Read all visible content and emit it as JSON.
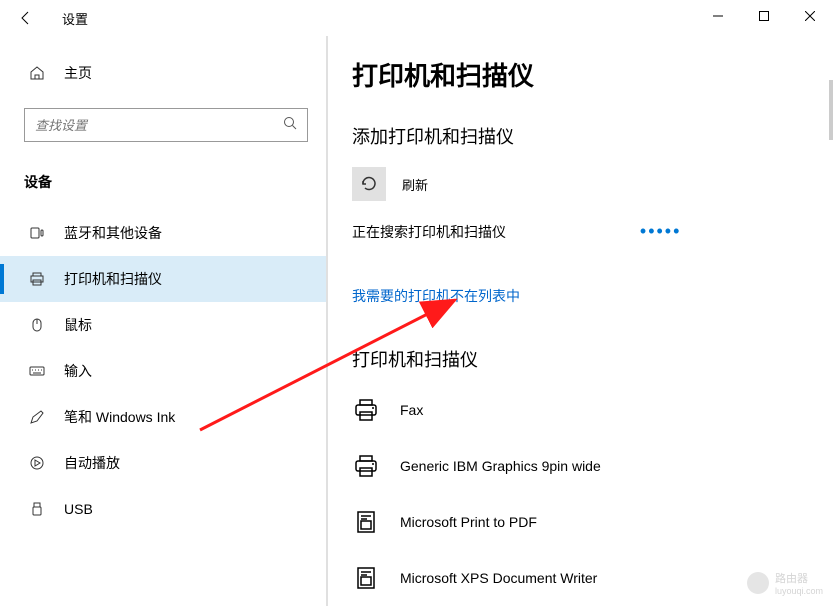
{
  "titlebar": {
    "app_title": "设置"
  },
  "sidebar": {
    "home_label": "主页",
    "search_placeholder": "查找设置",
    "section_header": "设备",
    "items": [
      {
        "label": "蓝牙和其他设备",
        "icon": "bluetooth"
      },
      {
        "label": "打印机和扫描仪",
        "icon": "printer",
        "active": true
      },
      {
        "label": "鼠标",
        "icon": "mouse"
      },
      {
        "label": "输入",
        "icon": "keyboard"
      },
      {
        "label": "笔和 Windows Ink",
        "icon": "pen"
      },
      {
        "label": "自动播放",
        "icon": "autoplay"
      },
      {
        "label": "USB",
        "icon": "usb"
      }
    ]
  },
  "content": {
    "page_title": "打印机和扫描仪",
    "add_section_title": "添加打印机和扫描仪",
    "refresh_label": "刷新",
    "searching_text": "正在搜索打印机和扫描仪",
    "dots": "•••••",
    "not_listed_link": "我需要的打印机不在列表中",
    "list_section_title": "打印机和扫描仪",
    "devices": [
      {
        "name": "Fax",
        "icon": "printer"
      },
      {
        "name": "Generic IBM Graphics 9pin wide",
        "icon": "printer"
      },
      {
        "name": "Microsoft Print to PDF",
        "icon": "doc-printer"
      },
      {
        "name": "Microsoft XPS Document Writer",
        "icon": "doc-printer"
      }
    ]
  },
  "watermark": {
    "text": "路由器",
    "sub": "luyouqi.com"
  }
}
